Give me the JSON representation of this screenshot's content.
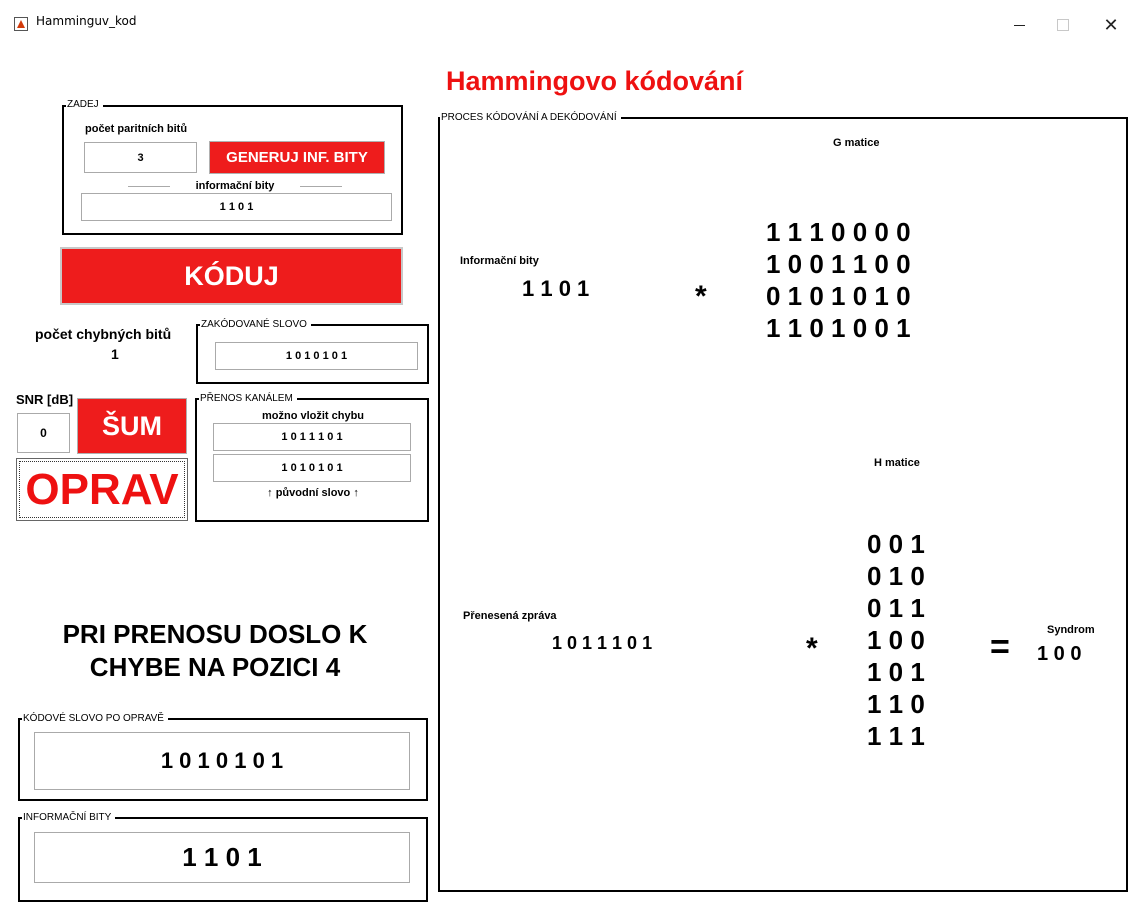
{
  "window": {
    "title": "Hamminguv_kod",
    "minimize_glyph": "",
    "close_glyph": "✕"
  },
  "main_title": "Hammingovo kódování",
  "zadej": {
    "frame_title": "ZADEJ",
    "parity_label": "počet paritních bitů",
    "parity_value": "3",
    "generate_button": "GENERUJ INF. BITY",
    "info_bits_label": "informační bity",
    "info_bits_value": "1 1 0 1"
  },
  "encode_button": "KÓDUJ",
  "error_bits": {
    "label": "počet chybných bitů",
    "value": "1"
  },
  "encoded_word": {
    "frame_title": "ZAKÓDOVANÉ SLOVO",
    "value": "1 0 1 0 1 0 1"
  },
  "snr": {
    "label": "SNR [dB]",
    "value": "0"
  },
  "noise_button": "ŠUM",
  "fix_button": "OPRAV",
  "channel": {
    "frame_title": "PŘENOS KANÁLEM",
    "hint": "možno vložit chybu",
    "received_value": "1 0 1 1 1 0 1",
    "original_value": "1 0 1 0 1 0 1",
    "original_label": "↑ původní slovo ↑"
  },
  "message": {
    "line1": "PRI PRENOSU DOSLO K",
    "line2": "CHYBE NA POZICI 4"
  },
  "corrected": {
    "frame_title": "KÓDOVÉ SLOVO PO OPRAVĚ",
    "value": "1 0 1 0 1 0 1"
  },
  "info_result": {
    "frame_title": "INFORMAČNÍ BITY",
    "value": "1 1 0 1"
  },
  "process": {
    "frame_title": "PROCES KÓDOVÁNÍ A DEKÓDOVÁNÍ",
    "g_title": "G matice",
    "info_label": "Informační bity",
    "info_value": "1 1 0 1",
    "mult_sign": "*",
    "g_rows": [
      "1 1 1 0 0 0 0",
      "1 0 0 1 1 0 0",
      "0 1 0 1 0 1 0",
      "1 1 0 1 0 0 1"
    ],
    "h_title": "H matice",
    "transmitted_label": "Přenesená zpráva",
    "transmitted_value": "1 0 1 1 1 0 1",
    "h_rows": [
      "0 0 1",
      "0 1 0",
      "0 1 1",
      "1 0 0",
      "1 0 1",
      "1 1 0",
      "1 1 1"
    ],
    "equals_sign": "=",
    "syndrome_label": "Syndrom",
    "syndrome_value": "1 0 0"
  }
}
